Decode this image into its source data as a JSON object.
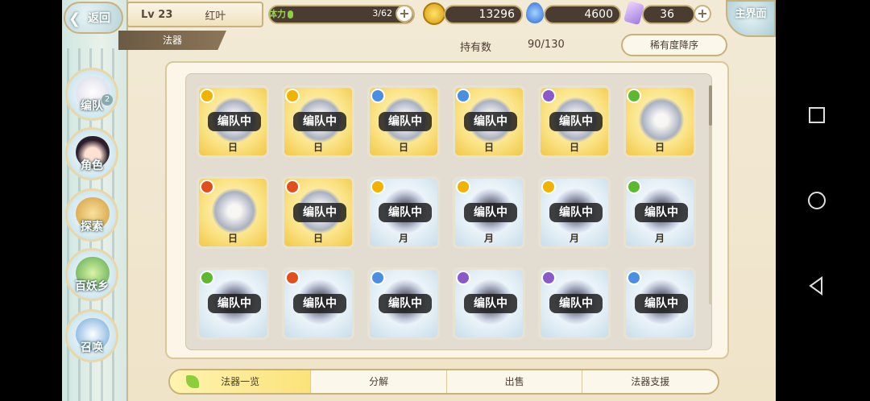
{
  "header": {
    "back_label": "返回",
    "level": "Lv 23",
    "player_name": "红叶",
    "stamina_label": "体力",
    "stamina_value": "3/62",
    "stamina_fraction": 0.048,
    "gold": "13296",
    "soul": "4600",
    "crystal": "36",
    "home_label": "主界面"
  },
  "category_tab": "法器",
  "inventory": {
    "count_label": "持有数",
    "count_value": "90/130",
    "sort_label": "稀有度降序"
  },
  "side_nav": [
    {
      "label": "编队",
      "badge": "2"
    },
    {
      "label": "角色"
    },
    {
      "label": "探索"
    },
    {
      "label": "百妖乡"
    },
    {
      "label": "召唤"
    }
  ],
  "cards": [
    {
      "type": "日",
      "badge": "编队中",
      "style": "sun",
      "elem": "#f0b400"
    },
    {
      "type": "日",
      "badge": "编队中",
      "style": "sun",
      "elem": "#f0b400"
    },
    {
      "type": "日",
      "badge": "编队中",
      "style": "sun",
      "elem": "#4a8fe0"
    },
    {
      "type": "日",
      "badge": "编队中",
      "style": "sun",
      "elem": "#4a8fe0"
    },
    {
      "type": "日",
      "badge": "编队中",
      "style": "sun",
      "elem": "#8a5ac8"
    },
    {
      "type": "日",
      "badge": "",
      "style": "sun",
      "elem": "#5cb82e"
    },
    {
      "type": "日",
      "badge": "",
      "style": "sun",
      "elem": "#e0501e"
    },
    {
      "type": "日",
      "badge": "编队中",
      "style": "sun",
      "elem": "#e0501e"
    },
    {
      "type": "月",
      "badge": "编队中",
      "style": "moon",
      "elem": "#f0b400"
    },
    {
      "type": "月",
      "badge": "编队中",
      "style": "moon",
      "elem": "#f0b400"
    },
    {
      "type": "月",
      "badge": "编队中",
      "style": "moon",
      "elem": "#f0b400"
    },
    {
      "type": "月",
      "badge": "编队中",
      "style": "moon",
      "elem": "#5cb82e"
    },
    {
      "type": "",
      "badge": "编队中",
      "style": "moon",
      "elem": "#5cb82e"
    },
    {
      "type": "",
      "badge": "编队中",
      "style": "moon",
      "elem": "#e0501e"
    },
    {
      "type": "",
      "badge": "编队中",
      "style": "moon",
      "elem": "#4a8fe0"
    },
    {
      "type": "",
      "badge": "编队中",
      "style": "moon",
      "elem": "#8a5ac8"
    },
    {
      "type": "",
      "badge": "编队中",
      "style": "moon",
      "elem": "#8a5ac8"
    },
    {
      "type": "",
      "badge": "编队中",
      "style": "moon",
      "elem": "#4a8fe0"
    }
  ],
  "bottom_tabs": [
    "法器一览",
    "分解",
    "出售",
    "法器支援"
  ]
}
